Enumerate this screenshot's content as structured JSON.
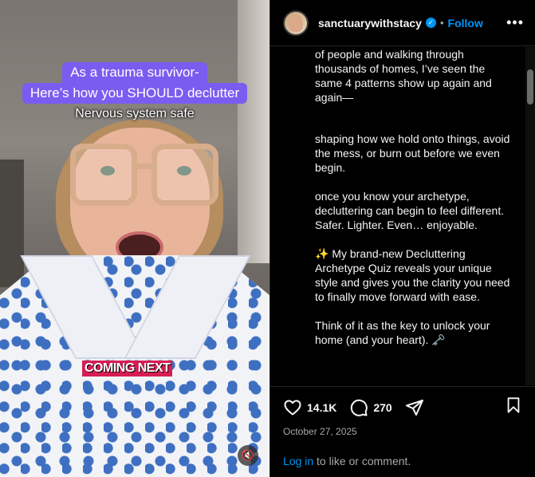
{
  "video": {
    "caption_line1": "As a trauma survivor-",
    "caption_line2": "Here’s how you SHOULD declutter",
    "subtitle": "Nervous system safe",
    "coming_next": "COMING NEXT",
    "mute_icon": "muted-speaker-icon"
  },
  "header": {
    "username": "sanctuarywithstacy",
    "verified_icon": "verified-badge-icon",
    "separator": "•",
    "follow_label": "Follow",
    "more_icon": "more-options-icon",
    "more_glyph": "•••"
  },
  "caption": {
    "paragraphs": [
      "of people and walking through thousands of homes, I’ve seen the same 4 patterns show up again and again—",
      "shaping how we hold onto things, avoid the mess, or burn out before we even begin.",
      "once you know your archetype, decluttering can begin to feel different. Safer. Lighter. Even… enjoyable.",
      "✨ My brand-new Decluttering Archetype Quiz reveals your unique style and gives you the clarity you need to finally move forward with ease.",
      "Think of it as the key to unlock your home (and your heart). 🗝️"
    ]
  },
  "actions": {
    "like_icon": "heart-icon",
    "like_count": "14.1K",
    "comment_icon": "comment-icon",
    "comment_count": "270",
    "share_icon": "share-icon",
    "save_icon": "bookmark-icon",
    "date": "October 27, 2025"
  },
  "footer": {
    "login_link": "Log in",
    "login_text": " to like or comment."
  },
  "colors": {
    "accent": "#0095f6",
    "caption_bg": "#7b5cf0",
    "coming_next_bg": "#d61d52"
  }
}
